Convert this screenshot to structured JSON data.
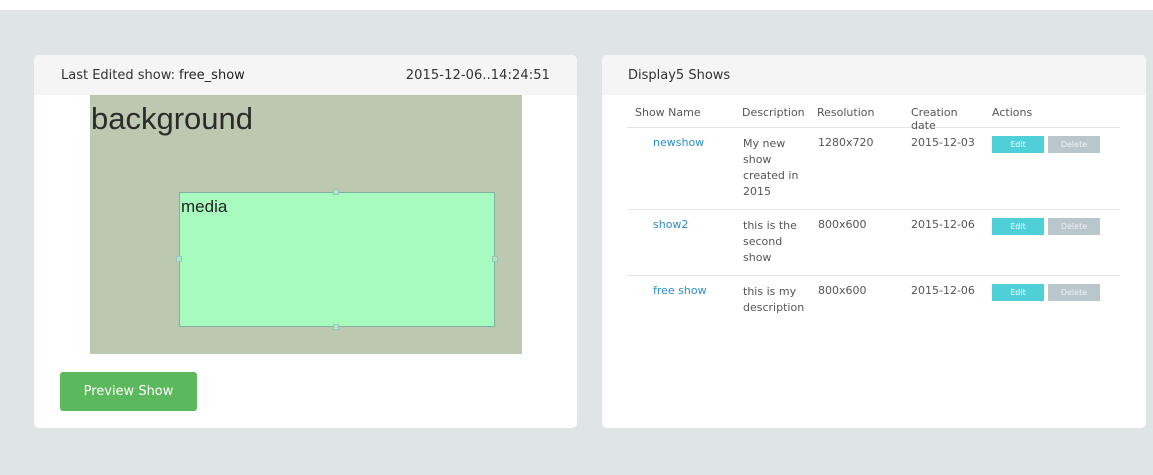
{
  "left_panel": {
    "header_label": "Last Edited show:",
    "show_name": "free_show",
    "timestamp": "2015-12-06..14:24:51",
    "canvas": {
      "background_label": "background",
      "media_label": "media"
    },
    "preview_button": "Preview Show"
  },
  "right_panel": {
    "title": "Display5 Shows",
    "columns": [
      "Show Name",
      "Description",
      "Resolution",
      "Creation date",
      "Actions"
    ],
    "rows": [
      {
        "name": "newshow",
        "description_lines": [
          "My new",
          "show",
          "created in",
          "2015"
        ],
        "resolution": "1280x720",
        "date": "2015-12-03",
        "edit": "Edit",
        "delete": "Delete"
      },
      {
        "name": "show2",
        "description_lines": [
          "this is the",
          "second",
          "show"
        ],
        "resolution": "800x600",
        "date": "2015-12-06",
        "edit": "Edit",
        "delete": "Delete"
      },
      {
        "name": "free show",
        "description_lines": [
          "this is my",
          "description"
        ],
        "resolution": "800x600",
        "date": "2015-12-06",
        "edit": "Edit",
        "delete": "Delete"
      }
    ]
  },
  "colors": {
    "page_bg": "#dfe5e4",
    "canvas_bg": "#bdc8b0",
    "media_bg": "#a8fbbe",
    "preview_btn": "#5cb85c",
    "edit_btn": "#4fd0d8",
    "delete_btn": "#b9c7cc",
    "link": "#2a8ec8"
  }
}
